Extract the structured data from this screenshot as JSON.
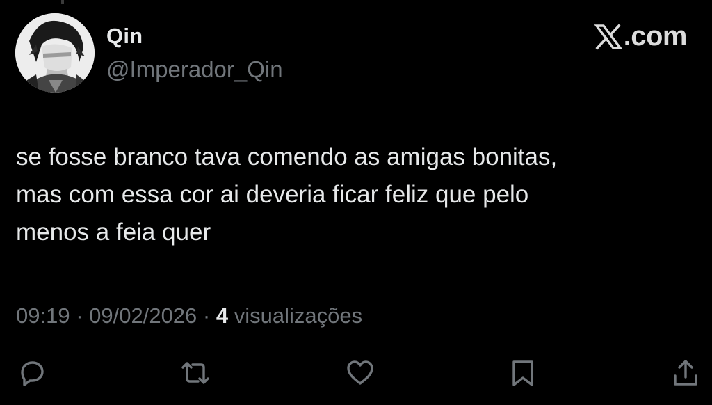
{
  "author": {
    "display_name": "Qin",
    "handle": "@Imperador_Qin"
  },
  "brand": {
    "logo_icon": "x-logo-icon",
    "text": ".com"
  },
  "tweet": {
    "text": "se fosse branco tava comendo as amigas bonitas,\nmas com essa cor ai deveria ficar feliz que pelo\nmenos a feia quer",
    "time": "09:19",
    "separator": " · ",
    "date": "09/02/2026",
    "views_count": "4",
    "views_label": " visualizações"
  },
  "actions": [
    {
      "name": "reply",
      "icon": "speech-bubble-icon"
    },
    {
      "name": "repost",
      "icon": "repost-arrows-icon"
    },
    {
      "name": "like",
      "icon": "heart-icon"
    },
    {
      "name": "bookmark",
      "icon": "bookmark-icon"
    },
    {
      "name": "share",
      "icon": "share-upload-icon"
    }
  ],
  "colors": {
    "background": "#000000",
    "primary_text": "#e7e9ea",
    "secondary_text": "#71767b",
    "icon": "#71767b"
  }
}
